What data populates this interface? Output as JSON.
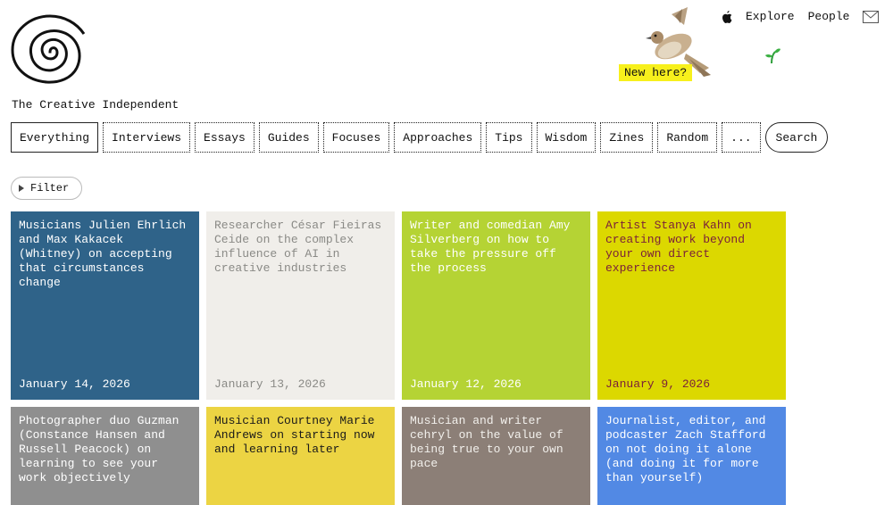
{
  "site": {
    "title": "The Creative Independent",
    "new_here": "New here?"
  },
  "topnav": {
    "explore": "Explore",
    "people": "People"
  },
  "tabs": [
    {
      "label": "Everything"
    },
    {
      "label": "Interviews"
    },
    {
      "label": "Essays"
    },
    {
      "label": "Guides"
    },
    {
      "label": "Focuses"
    },
    {
      "label": "Approaches"
    },
    {
      "label": "Tips"
    },
    {
      "label": "Wisdom"
    },
    {
      "label": "Zines"
    },
    {
      "label": "Random"
    },
    {
      "label": "..."
    },
    {
      "label": "Search"
    }
  ],
  "filter": {
    "label": "Filter"
  },
  "cards": [
    {
      "title": "Musicians Julien Ehrlich and Max Kakacek (Whitney) on accepting that circumstances change",
      "date": "January 14, 2026",
      "bg": "#2f6389",
      "fg": "#ffffff"
    },
    {
      "title": "Researcher César Fieiras Ceide on the complex influence of AI in creative industries",
      "date": "January 13, 2026",
      "bg": "#f0eeea",
      "fg": "#8a8a86"
    },
    {
      "title": "Writer and comedian Amy Silverberg on how to take the pressure off the process",
      "date": "January 12, 2026",
      "bg": "#b5d334",
      "fg": "#ffffff"
    },
    {
      "title": "Artist Stanya Kahn on creating work beyond your own direct experience",
      "date": "January 9, 2026",
      "bg": "#dcd800",
      "fg": "#7a1f3a"
    },
    {
      "title": "Photographer duo Guzman (Constance Hansen and Russell Peacock) on learning to see your work objectively",
      "date": "",
      "bg": "#8f8f8f",
      "fg": "#ffffff"
    },
    {
      "title": "Musician Courtney Marie Andrews on starting now and learning later",
      "date": "",
      "bg": "#ecd443",
      "fg": "#1a1a1a"
    },
    {
      "title": "Musician and writer cehryl on the value of being true to your own pace",
      "date": "",
      "bg": "#8c7f77",
      "fg": "#f2f0ec"
    },
    {
      "title": "Journalist, editor, and podcaster Zach Stafford on not doing it alone (and doing it for more than yourself)",
      "date": "",
      "bg": "#5289e4",
      "fg": "#ffffff"
    }
  ]
}
